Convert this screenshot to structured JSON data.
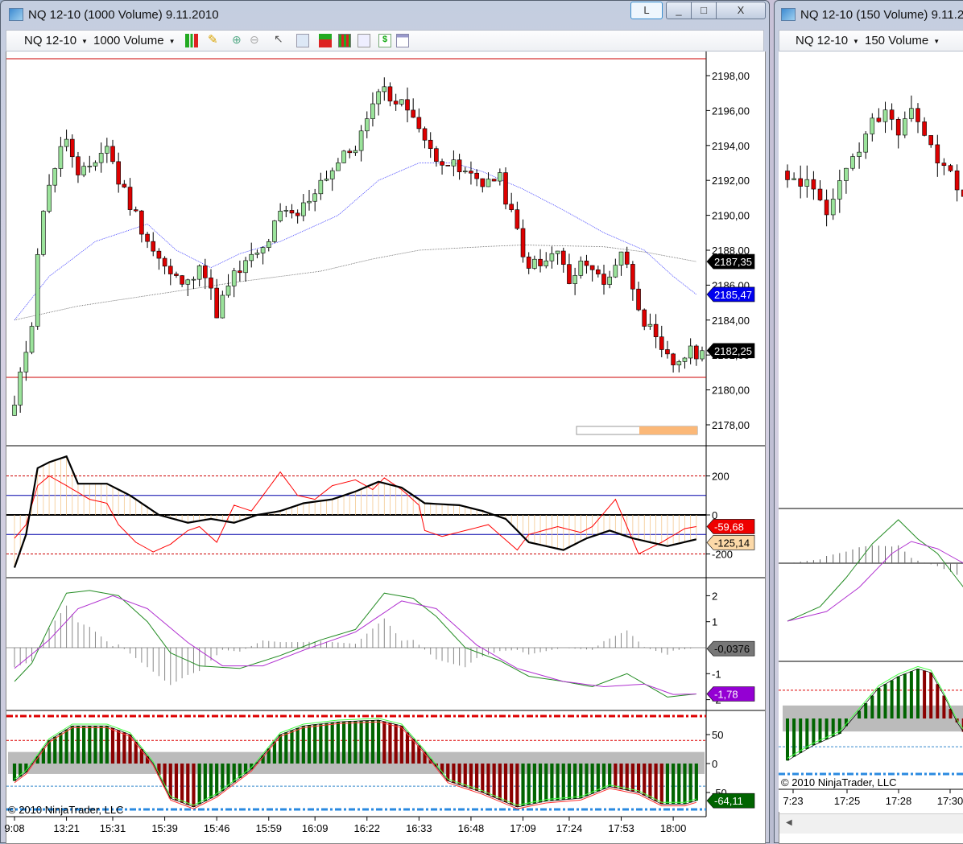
{
  "main_window": {
    "title": "NQ 12-10 (1000 Volume)  9.11.2010",
    "link_button": "L",
    "minimize_label": "_",
    "maximize_label": "□",
    "close_label": "X",
    "toolbar": {
      "instrument": "NQ 12-10",
      "interval": "1000 Volume",
      "icons": [
        "bar-type-icon",
        "drawing-pencil-icon",
        "zoom-in-icon",
        "zoom-out-icon",
        "cursor-pointer-icon",
        "search-zoom-icon",
        "order-entry-icon",
        "strategy-icon",
        "indicators-icon",
        "dollar-icon",
        "properties-icon"
      ]
    },
    "copyright": "© 2010 NinjaTrader, LLC"
  },
  "second_window": {
    "title": "NQ 12-10 (150 Volume)  9.11.2",
    "instrument": "NQ 12-10",
    "interval": "150 Volume",
    "copyright": "© 2010 NinjaTrader, LLC",
    "time_labels": [
      "7:23",
      "17:25",
      "17:28",
      "17:30"
    ]
  },
  "chart_data": {
    "type": "candlestick",
    "bars": 120,
    "price_axis": {
      "range": [
        2177,
        2199
      ],
      "ticks": [
        {
          "v": 2198,
          "label": "2198,00"
        },
        {
          "v": 2196,
          "label": "2196,00"
        },
        {
          "v": 2194,
          "label": "2194,00"
        },
        {
          "v": 2192,
          "label": "2192,00"
        },
        {
          "v": 2190,
          "label": "2190,00"
        },
        {
          "v": 2188,
          "label": "2188,00"
        },
        {
          "v": 2186,
          "label": "2186,00"
        },
        {
          "v": 2184,
          "label": "2184,00"
        },
        {
          "v": 2182,
          "label": "2182,00"
        },
        {
          "v": 2180,
          "label": "2180,00"
        },
        {
          "v": 2178,
          "label": "2178,00"
        }
      ]
    },
    "close_keypoints": [
      [
        0,
        2179
      ],
      [
        3,
        2184
      ],
      [
        4,
        2188
      ],
      [
        6,
        2192
      ],
      [
        9,
        2194.5
      ],
      [
        11,
        2192
      ],
      [
        16,
        2194
      ],
      [
        18,
        2192
      ],
      [
        21,
        2190
      ],
      [
        24,
        2188
      ],
      [
        27,
        2186.5
      ],
      [
        30,
        2186
      ],
      [
        32,
        2187.5
      ],
      [
        35,
        2184.5
      ],
      [
        38,
        2186.5
      ],
      [
        41,
        2187.5
      ],
      [
        43,
        2188
      ],
      [
        46,
        2190
      ],
      [
        49,
        2190
      ],
      [
        53,
        2192
      ],
      [
        56,
        2193
      ],
      [
        59,
        2194
      ],
      [
        62,
        2196
      ],
      [
        63,
        2197.5
      ],
      [
        66,
        2196.5
      ],
      [
        69,
        2196
      ],
      [
        71,
        2194
      ],
      [
        73,
        2193.5
      ],
      [
        77,
        2192.5
      ],
      [
        81,
        2192
      ],
      [
        84,
        2192
      ],
      [
        87,
        2189
      ],
      [
        88,
        2187.5
      ],
      [
        91,
        2187
      ],
      [
        94,
        2188
      ],
      [
        96,
        2186
      ],
      [
        99,
        2187.5
      ],
      [
        102,
        2186
      ],
      [
        105,
        2188
      ],
      [
        108,
        2185
      ],
      [
        109,
        2184
      ],
      [
        112,
        2182
      ],
      [
        114,
        2181.5
      ],
      [
        116,
        2182
      ],
      [
        119,
        2182.25
      ]
    ],
    "ma_blue": [
      [
        0,
        2184
      ],
      [
        6,
        2186.5
      ],
      [
        14,
        2188.5
      ],
      [
        23,
        2189.5
      ],
      [
        28,
        2188
      ],
      [
        34,
        2187
      ],
      [
        39,
        2187.8
      ],
      [
        46,
        2188.5
      ],
      [
        56,
        2190
      ],
      [
        63,
        2192
      ],
      [
        70,
        2193
      ],
      [
        76,
        2193
      ],
      [
        81,
        2192.5
      ],
      [
        88,
        2191.5
      ],
      [
        95,
        2190.3
      ],
      [
        102,
        2189
      ],
      [
        109,
        2188
      ],
      [
        114,
        2186.5
      ],
      [
        118,
        2185.47
      ]
    ],
    "ma_gray": [
      [
        0,
        2184
      ],
      [
        11,
        2184.8
      ],
      [
        25,
        2185.5
      ],
      [
        39,
        2186.2
      ],
      [
        53,
        2186.8
      ],
      [
        62,
        2187.5
      ],
      [
        70,
        2188
      ],
      [
        81,
        2188.2
      ],
      [
        88,
        2188.3
      ],
      [
        102,
        2188.2
      ],
      [
        109,
        2187.9
      ],
      [
        118,
        2187.35
      ]
    ],
    "red_levels": [
      2199,
      2180.72
    ],
    "bar_progress": 0.48,
    "price_markers": [
      {
        "v": 2187.35,
        "label": "2187,35",
        "color": "#000000"
      },
      {
        "v": 2185.47,
        "label": "2185,47",
        "color": "#0000ee"
      },
      {
        "v": 2182.25,
        "label": "2182,25",
        "color": "#000000"
      }
    ],
    "cci": {
      "ticks": [
        {
          "v": 200,
          "label": "200"
        },
        {
          "v": 0,
          "label": "0"
        },
        {
          "v": -200,
          "label": "-200"
        }
      ],
      "red": [
        [
          0,
          -120
        ],
        [
          2,
          -50
        ],
        [
          4,
          150
        ],
        [
          6,
          200
        ],
        [
          9,
          150
        ],
        [
          13,
          80
        ],
        [
          16,
          60
        ],
        [
          18,
          -50
        ],
        [
          21,
          -140
        ],
        [
          24,
          -190
        ],
        [
          27,
          -150
        ],
        [
          30,
          -80
        ],
        [
          32,
          -60
        ],
        [
          35,
          -140
        ],
        [
          38,
          50
        ],
        [
          41,
          20
        ],
        [
          43,
          100
        ],
        [
          46,
          220
        ],
        [
          49,
          100
        ],
        [
          52,
          80
        ],
        [
          55,
          150
        ],
        [
          59,
          180
        ],
        [
          62,
          130
        ],
        [
          64,
          190
        ],
        [
          67,
          130
        ],
        [
          70,
          50
        ],
        [
          71,
          -80
        ],
        [
          74,
          -110
        ],
        [
          78,
          -80
        ],
        [
          82,
          -50
        ],
        [
          87,
          -180
        ],
        [
          89,
          -100
        ],
        [
          94,
          -60
        ],
        [
          98,
          -90
        ],
        [
          100,
          -60
        ],
        [
          104,
          80
        ],
        [
          108,
          -200
        ],
        [
          112,
          -140
        ],
        [
          116,
          -70
        ],
        [
          118,
          -59.68
        ]
      ],
      "black": [
        [
          0,
          -270
        ],
        [
          2,
          -100
        ],
        [
          4,
          240
        ],
        [
          6,
          270
        ],
        [
          9,
          300
        ],
        [
          11,
          160
        ],
        [
          16,
          160
        ],
        [
          20,
          100
        ],
        [
          25,
          0
        ],
        [
          30,
          -40
        ],
        [
          34,
          -20
        ],
        [
          38,
          -40
        ],
        [
          42,
          0
        ],
        [
          46,
          20
        ],
        [
          50,
          60
        ],
        [
          55,
          80
        ],
        [
          59,
          120
        ],
        [
          63,
          170
        ],
        [
          67,
          140
        ],
        [
          71,
          60
        ],
        [
          77,
          50
        ],
        [
          81,
          20
        ],
        [
          85,
          -20
        ],
        [
          89,
          -140
        ],
        [
          95,
          -180
        ],
        [
          99,
          -120
        ],
        [
          103,
          -80
        ],
        [
          107,
          -120
        ],
        [
          113,
          -160
        ],
        [
          118,
          -125.14
        ]
      ],
      "markers": [
        {
          "v": -59.68,
          "label": "-59,68",
          "color": "#ee0000",
          "text": "#ffffff"
        },
        {
          "v": -125.14,
          "label": "-125,14",
          "color": "#fcd9a8",
          "text": "#000000"
        }
      ]
    },
    "macd": {
      "ticks": [
        {
          "v": 2,
          "label": "2"
        },
        {
          "v": 1,
          "label": "1"
        },
        {
          "v": -1,
          "label": "-1"
        },
        {
          "v": -2,
          "label": "-2"
        }
      ],
      "green": [
        [
          0,
          -1.3
        ],
        [
          3,
          -0.6
        ],
        [
          6,
          0.8
        ],
        [
          9,
          2.1
        ],
        [
          13,
          2.2
        ],
        [
          18,
          2
        ],
        [
          23,
          1
        ],
        [
          27,
          -0.2
        ],
        [
          32,
          -0.7
        ],
        [
          39,
          -0.8
        ],
        [
          46,
          -0.3
        ],
        [
          53,
          0.3
        ],
        [
          59,
          0.7
        ],
        [
          64,
          2.1
        ],
        [
          69,
          1.9
        ],
        [
          73,
          1.2
        ],
        [
          78,
          0
        ],
        [
          84,
          -0.5
        ],
        [
          89,
          -1.1
        ],
        [
          95,
          -1.3
        ],
        [
          100,
          -1.5
        ],
        [
          106,
          -1
        ],
        [
          113,
          -1.9
        ],
        [
          118,
          -1.78
        ]
      ],
      "purple": [
        [
          0,
          -0.8
        ],
        [
          6,
          0.3
        ],
        [
          11,
          1.5
        ],
        [
          17,
          2
        ],
        [
          23,
          1.5
        ],
        [
          30,
          0.2
        ],
        [
          36,
          -0.7
        ],
        [
          43,
          -0.7
        ],
        [
          50,
          -0.1
        ],
        [
          59,
          0.6
        ],
        [
          67,
          1.8
        ],
        [
          73,
          1.5
        ],
        [
          80,
          0.1
        ],
        [
          87,
          -0.8
        ],
        [
          95,
          -1.3
        ],
        [
          102,
          -1.5
        ],
        [
          109,
          -1.4
        ],
        [
          114,
          -1.8
        ],
        [
          118,
          -1.78
        ]
      ],
      "markers": [
        {
          "v": -0.0376,
          "label": "-0,0376",
          "color": "#777777",
          "text": "#000000"
        },
        {
          "v": -1.78,
          "label": "-1,78",
          "color": "#9400d3",
          "text": "#ffffff"
        }
      ]
    },
    "oscillator": {
      "ticks": [
        {
          "v": 50,
          "label": "50"
        },
        {
          "v": 0,
          "label": "0"
        },
        {
          "v": -50,
          "label": "-50"
        }
      ],
      "values": [
        [
          0,
          -30
        ],
        [
          2,
          -15
        ],
        [
          6,
          40
        ],
        [
          10,
          65
        ],
        [
          16,
          65
        ],
        [
          20,
          50
        ],
        [
          24,
          0
        ],
        [
          27,
          -60
        ],
        [
          31,
          -75
        ],
        [
          35,
          -55
        ],
        [
          41,
          -10
        ],
        [
          46,
          50
        ],
        [
          50,
          65
        ],
        [
          56,
          72
        ],
        [
          63,
          75
        ],
        [
          67,
          65
        ],
        [
          71,
          20
        ],
        [
          75,
          -30
        ],
        [
          81,
          -50
        ],
        [
          87,
          -75
        ],
        [
          92,
          -65
        ],
        [
          98,
          -60
        ],
        [
          103,
          -40
        ],
        [
          108,
          -50
        ],
        [
          112,
          -70
        ],
        [
          116,
          -70
        ],
        [
          118,
          -64.11
        ]
      ],
      "markers": [
        {
          "v": -64.11,
          "label": "-64,11",
          "color": "#006400",
          "text": "#ffffff"
        }
      ]
    },
    "time_labels": [
      {
        "bar": 0,
        "label": "9:08"
      },
      {
        "bar": 9,
        "label": "13:21"
      },
      {
        "bar": 17,
        "label": "15:31"
      },
      {
        "bar": 26,
        "label": "15:39"
      },
      {
        "bar": 35,
        "label": "15:46"
      },
      {
        "bar": 44,
        "label": "15:59"
      },
      {
        "bar": 52,
        "label": "16:09"
      },
      {
        "bar": 61,
        "label": "16:22"
      },
      {
        "bar": 70,
        "label": "16:33"
      },
      {
        "bar": 79,
        "label": "16:48"
      },
      {
        "bar": 88,
        "label": "17:09"
      },
      {
        "bar": 96,
        "label": "17:24"
      },
      {
        "bar": 105,
        "label": "17:53"
      },
      {
        "bar": 114,
        "label": "18:00"
      }
    ]
  },
  "second_chart_data": {
    "close_keypoints": [
      [
        0,
        2191
      ],
      [
        3,
        2191
      ],
      [
        6,
        2189.5
      ],
      [
        8,
        2191
      ],
      [
        11,
        2193
      ],
      [
        13,
        2194.5
      ],
      [
        15,
        2195
      ],
      [
        17,
        2194
      ],
      [
        19,
        2195
      ],
      [
        21,
        2194
      ],
      [
        23,
        2192
      ],
      [
        25,
        2191.5
      ],
      [
        27,
        2190
      ]
    ],
    "macd_green": [
      [
        0,
        -1.2
      ],
      [
        5,
        -0.9
      ],
      [
        9,
        -0.3
      ],
      [
        13,
        0.4
      ],
      [
        17,
        0.9
      ],
      [
        20,
        0.5
      ],
      [
        23,
        0.2
      ],
      [
        27,
        -0.5
      ]
    ],
    "macd_purple": [
      [
        0,
        -1.2
      ],
      [
        6,
        -1.0
      ],
      [
        11,
        -0.5
      ],
      [
        16,
        0.2
      ],
      [
        19,
        0.45
      ],
      [
        23,
        0.3
      ],
      [
        27,
        0
      ]
    ],
    "oscillator": [
      [
        0,
        -55
      ],
      [
        4,
        -35
      ],
      [
        8,
        -20
      ],
      [
        11,
        10
      ],
      [
        14,
        40
      ],
      [
        17,
        55
      ],
      [
        20,
        65
      ],
      [
        22,
        60
      ],
      [
        24,
        30
      ],
      [
        26,
        -5
      ],
      [
        28,
        -30
      ]
    ]
  }
}
